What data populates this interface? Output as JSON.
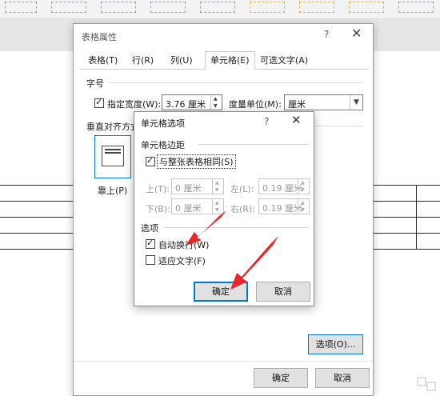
{
  "main_dialog": {
    "title": "表格属性",
    "help": "?",
    "tabs": [
      "表格(T)",
      "行(R)",
      "列(U)",
      "单元格(E)",
      "可选文字(A)"
    ],
    "size_group": "字号",
    "preferred_width_label": "指定宽度(W):",
    "preferred_width_value": "3.76 厘米",
    "measure_in_label": "度量单位(M):",
    "measure_in_value": "厘米",
    "vertical_alignment_label": "垂直对齐方式",
    "align_top_label": "靠上(P)",
    "options_button": "选项(O)...",
    "ok_button": "确定",
    "cancel_button": "取消"
  },
  "cell_options": {
    "title": "单元格选项",
    "help": "?",
    "margins_group": "单元格边距",
    "same_as_table_label": "与整张表格相同(S)",
    "same_as_table_checked": true,
    "top_label": "上(T):",
    "top_value": "0 厘米",
    "left_label": "左(L):",
    "left_value": "0.19 厘米",
    "bottom_label": "下(B):",
    "bottom_value": "0 厘米",
    "right_label": "右(R):",
    "right_value": "0.19 厘米",
    "options_group": "选项",
    "wrap_text_label": "自动换行(W)",
    "wrap_text_checked": true,
    "fit_text_label": "适应文字(F)",
    "fit_text_checked": false,
    "ok_button": "确定",
    "cancel_button": "取消"
  },
  "colors": {
    "focus_blue": "#0078d7",
    "arrow_red": "#e8262c"
  }
}
